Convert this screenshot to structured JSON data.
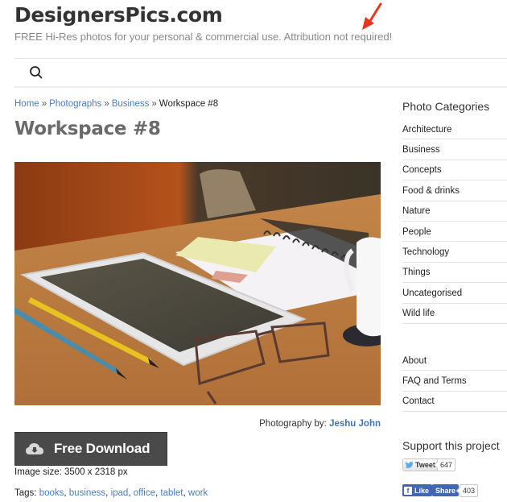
{
  "site": {
    "title": "DesignersPics.com",
    "tagline": "FREE Hi-Res photos for your personal & commercial use. Attribution not required!"
  },
  "nav": {
    "search_icon": "search-icon"
  },
  "breadcrumb": {
    "items": [
      "Home",
      "Photographs",
      "Business"
    ],
    "current": "Workspace #8",
    "separator": "»"
  },
  "page": {
    "title": "Workspace #8",
    "photo_alt": "Desk with tablet, notebook, sticky notes, pencils, glasses and mug",
    "credit_label": "Photography by:",
    "credit_name": "Jeshu John",
    "download_label": "Free Download",
    "download_icon": "cloud-download-icon",
    "image_size": "Image size: 3500 x 2318 px",
    "tags_label": "Tags:",
    "tags": [
      "books",
      "business",
      "ipad",
      "office",
      "tablet",
      "work"
    ]
  },
  "sidebar": {
    "categories_heading": "Photo Categories",
    "categories": [
      "Architecture",
      "Business",
      "Concepts",
      "Food & drinks",
      "Nature",
      "People",
      "Technology",
      "Things",
      "Uncategorised",
      "Wild life"
    ],
    "pages": [
      "About",
      "FAQ and Terms",
      "Contact"
    ],
    "support_heading": "Support this project",
    "tweet_label": "Tweet",
    "tweet_count": "647",
    "fb_like_label": "Like",
    "fb_share_label": "Share",
    "fb_count": "403"
  },
  "colors": {
    "link": "#4a7bc4",
    "button_bg": "#4a4a4a",
    "facebook": "#4267b2",
    "annotation_arrow": "#e8361e"
  }
}
